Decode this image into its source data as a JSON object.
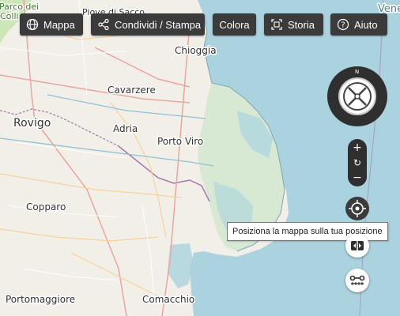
{
  "toolbar": {
    "buttons": [
      {
        "label": "Mappa",
        "icon": "globe-icon"
      },
      {
        "label": "Condividi / Stampa",
        "icon": "share-icon"
      },
      {
        "label": "Colora",
        "icon": ""
      },
      {
        "label": "Storia",
        "icon": "history-frame-icon"
      },
      {
        "label": "Aiuto",
        "icon": "help-icon"
      }
    ]
  },
  "map": {
    "places": {
      "chioggia": "Chioggia",
      "cavarzere": "Cavarzere",
      "rovigo": "Rovigo",
      "adria": "Adria",
      "porto_viro": "Porto Viro",
      "copparo": "Copparo",
      "portomaggiore": "Portomaggiore",
      "comacchio": "Comacchio",
      "piove_di_sacco": "Piove di Sacco",
      "venezia": "Venezia",
      "parco": "Parco dei",
      "colli": "Colli"
    },
    "colors": {
      "land": "#f2efe9",
      "sea": "#aad3df",
      "marsh": "#d7e9d3",
      "border": "#9e7ba8"
    }
  },
  "controls": {
    "compass_north": "N",
    "zoom_in": "+",
    "reset": "↻",
    "zoom_out": "−",
    "locate_tooltip": "Posiziona la mappa sulla tua posizione"
  }
}
